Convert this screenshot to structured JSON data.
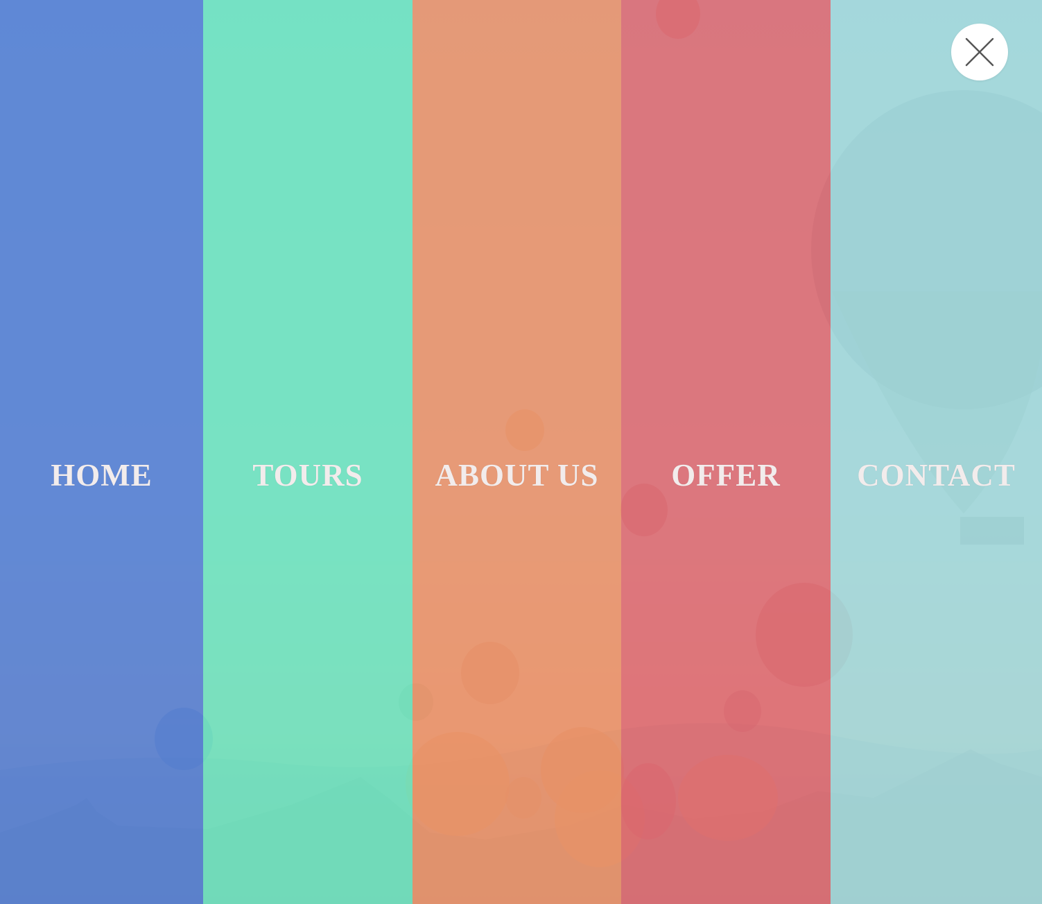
{
  "menu": {
    "items": [
      {
        "label": "HOME",
        "color": "#5580d4"
      },
      {
        "label": "TOURS",
        "color": "#6ee2c0"
      },
      {
        "label": "ABOUT US",
        "color": "#e9926b"
      },
      {
        "label": "OFFER",
        "color": "#dd6c73"
      },
      {
        "label": "CONTACT",
        "color": "#a2d7da"
      }
    ]
  },
  "close_button": {
    "icon": "close-icon"
  },
  "background": {
    "description_icon": "hot-air-balloons-landscape"
  }
}
